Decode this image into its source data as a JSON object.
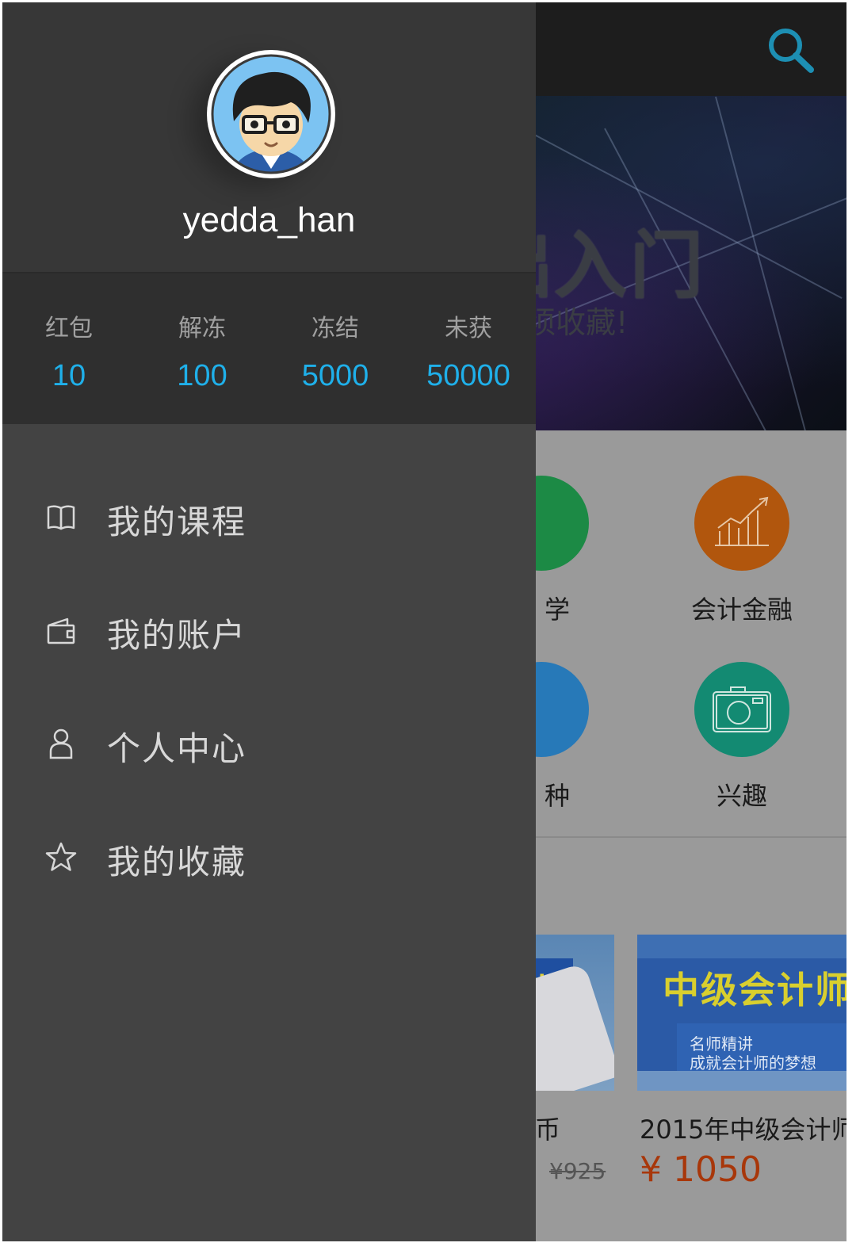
{
  "drawer": {
    "username": "yedda_han",
    "stats": [
      {
        "label": "红包",
        "value": "10"
      },
      {
        "label": "解冻",
        "value": "100"
      },
      {
        "label": "冻结",
        "value": "5000"
      },
      {
        "label": "未获",
        "value": "50000"
      }
    ],
    "menu": [
      {
        "icon": "book-icon",
        "label": "我的课程"
      },
      {
        "icon": "wallet-icon",
        "label": "我的账户"
      },
      {
        "icon": "person-icon",
        "label": "个人中心"
      },
      {
        "icon": "star-icon",
        "label": "我的收藏"
      }
    ]
  },
  "background": {
    "banner": {
      "title_partial": "础入门",
      "subtitle_partial": "须收藏!"
    },
    "categories": [
      {
        "label_partial": "学",
        "color": "#1c8a45",
        "icon": "leaf-icon"
      },
      {
        "label": "会计金融",
        "color": "#b1560d",
        "icon": "chart-icon"
      },
      {
        "label_partial": "种",
        "color": "#2779b8",
        "icon": "chat-icon"
      },
      {
        "label": "兴趣",
        "color": "#138a72",
        "icon": "camera-icon"
      }
    ],
    "courses": [
      {
        "image_text": "师",
        "title_partial": "币",
        "old_price": "¥925"
      },
      {
        "image_headline": "中级会计师",
        "image_sub1": "名师精讲",
        "image_sub2": "成就会计师的梦想",
        "title": "2015年中级会计师",
        "price": "¥ 1050"
      }
    ]
  },
  "colors": {
    "accent": "#1fb0ea",
    "drawer_bg": "#434343",
    "price": "#a8370a"
  }
}
